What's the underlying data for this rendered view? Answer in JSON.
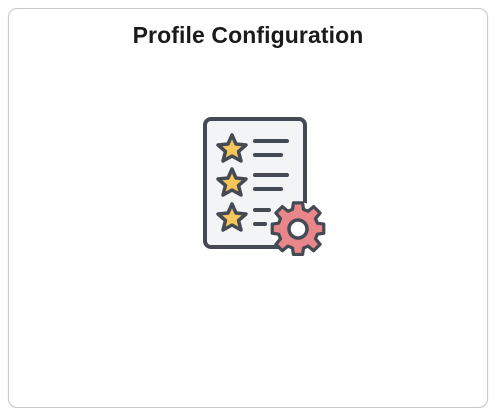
{
  "tile": {
    "title": "Profile Configuration",
    "icon": "profile-configuration-icon"
  },
  "colors": {
    "border": "#c9c9c9",
    "title_text": "#1b1b1b",
    "document_fill": "#f3f4f6",
    "document_stroke": "#434a54",
    "star_fill": "#f5c65a",
    "gear_fill": "#e8868a",
    "gear_stroke": "#434a54"
  }
}
